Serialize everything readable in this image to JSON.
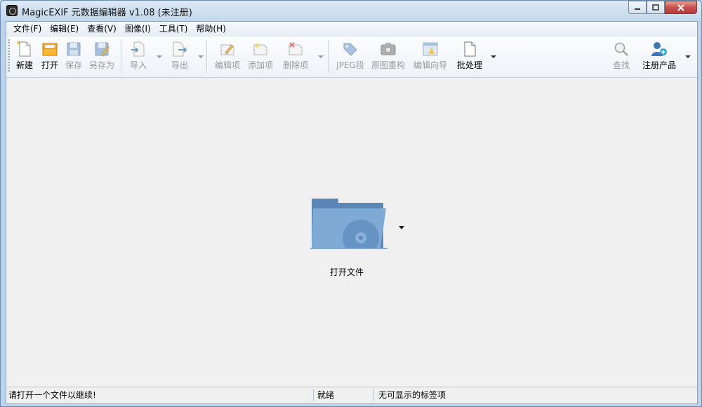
{
  "window": {
    "title": "MagicEXIF 元数据编辑器 v1.08 (未注册)"
  },
  "menu": {
    "file": "文件(F)",
    "edit": "编辑(E)",
    "view": "查看(V)",
    "image": "图像(I)",
    "tools": "工具(T)",
    "help": "帮助(H)"
  },
  "toolbar": {
    "new": "新建",
    "open": "打开",
    "save": "保存",
    "save_as": "另存为",
    "import": "导入",
    "export": "导出",
    "edit_item": "编辑项",
    "add_item": "添加项",
    "delete_item": "删除项",
    "jpeg_segment": "JPEG段",
    "rebuild_original": "原图重构",
    "edit_wizard": "编辑向导",
    "batch": "批处理",
    "find": "查找",
    "register": "注册产品"
  },
  "workspace": {
    "open_file_label": "打开文件"
  },
  "status": {
    "message": "请打开一个文件以继续!",
    "state": "就绪",
    "tags": "无可显示的标签项"
  },
  "colors": {
    "accent": "#4f81b8",
    "folder": "#6f9ccb",
    "disabled_text": "#9a9a9a"
  }
}
